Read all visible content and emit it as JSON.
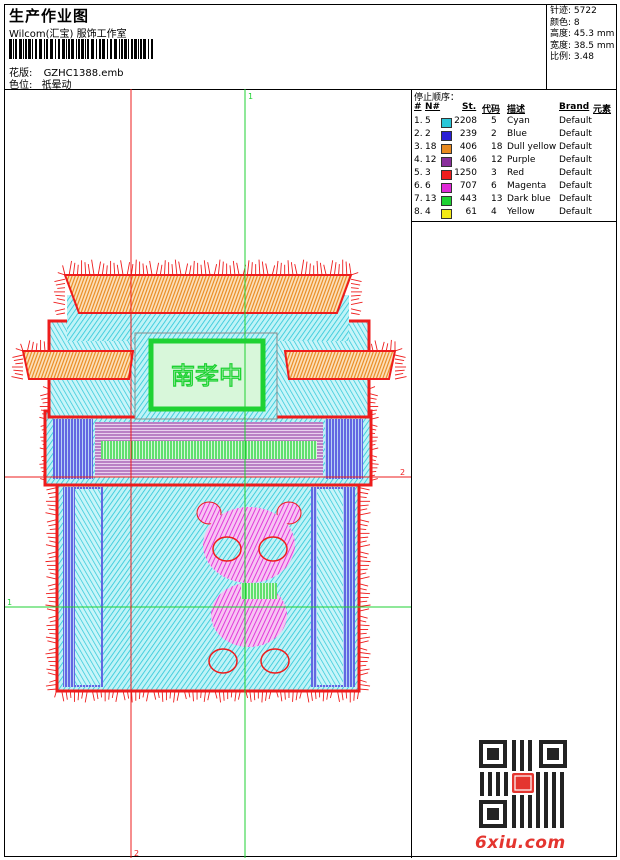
{
  "header": {
    "title": "生产作业图",
    "subtitle": "Wilcom(汇宝) 服饰工作室",
    "design_label": "花版:",
    "design_file": "GZHC1388.emb",
    "color_label": "色位:",
    "color_value": "祇晕动"
  },
  "stats": {
    "stitches_label": "针迹:",
    "stitches": "5722",
    "colors_label": "颜色:",
    "colors": "8",
    "height_label": "高度:",
    "height": "45.3 mm",
    "width_label": "宽度:",
    "width": "38.5 mm",
    "ratio_label": "比例:",
    "ratio": "3.48"
  },
  "stop_sequence": {
    "title": "停止顺序：",
    "headers": {
      "num": "#",
      "no": "N#",
      "st": "St.",
      "code": "代码",
      "desc": "描述",
      "brand": "Brand",
      "elem": "元素"
    },
    "rows": [
      {
        "idx": "1.",
        "n": "5",
        "color": "#29c6d8",
        "st": "2208",
        "code": "5",
        "name": "Cyan",
        "brand": "Default"
      },
      {
        "idx": "2.",
        "n": "2",
        "color": "#2a1fd6",
        "st": "239",
        "code": "2",
        "name": "Blue",
        "brand": "Default"
      },
      {
        "idx": "3.",
        "n": "18",
        "color": "#e98a1e",
        "st": "406",
        "code": "18",
        "name": "Dull yellow",
        "brand": "Default"
      },
      {
        "idx": "4.",
        "n": "12",
        "color": "#8a2f9c",
        "st": "406",
        "code": "12",
        "name": "Purple",
        "brand": "Default"
      },
      {
        "idx": "5.",
        "n": "3",
        "color": "#ee1c1c",
        "st": "1250",
        "code": "3",
        "name": "Red",
        "brand": "Default"
      },
      {
        "idx": "6.",
        "n": "6",
        "color": "#e02ad8",
        "st": "707",
        "code": "6",
        "name": "Magenta",
        "brand": "Default"
      },
      {
        "idx": "7.",
        "n": "13",
        "color": "#1fd233",
        "st": "443",
        "code": "13",
        "name": "Dark blue",
        "brand": "Default"
      },
      {
        "idx": "8.",
        "n": "4",
        "color": "#f3ea16",
        "st": "61",
        "code": "4",
        "name": "Yellow",
        "brand": "Default"
      }
    ]
  },
  "canvas": {
    "guide_top": "1",
    "guide_right": "2",
    "guide_left": "1",
    "guide_bottom": "2",
    "sign_text": "南孝中"
  },
  "watermark": {
    "site_prefix": "6",
    "site_rest": "xiu.com"
  }
}
